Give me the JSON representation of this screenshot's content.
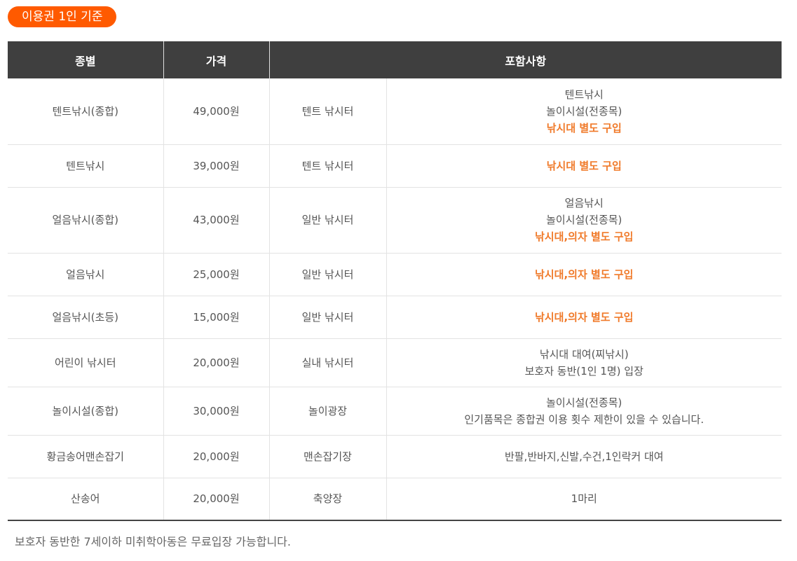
{
  "badge": {
    "label": "이용권 1인 기준"
  },
  "table": {
    "headers": [
      "종별",
      "가격",
      "포함사항"
    ],
    "rows": [
      {
        "type": "텐트낚시(종합)",
        "price": "49,000원",
        "area": "텐트 낚시터",
        "lines": [
          {
            "text": "텐트낚시",
            "accent": false
          },
          {
            "text": "놀이시설(전종목)",
            "accent": false
          },
          {
            "text": "낚시대 별도 구입",
            "accent": true
          }
        ]
      },
      {
        "type": "텐트낚시",
        "price": "39,000원",
        "area": "텐트 낚시터",
        "lines": [
          {
            "text": "낚시대 별도 구입",
            "accent": true
          }
        ]
      },
      {
        "type": "얼음낚시(종합)",
        "price": "43,000원",
        "area": "일반 낚시터",
        "lines": [
          {
            "text": "얼음낚시",
            "accent": false
          },
          {
            "text": "놀이시설(전종목)",
            "accent": false
          },
          {
            "text": "낚시대,의자 별도 구입",
            "accent": true
          }
        ]
      },
      {
        "type": "얼음낚시",
        "price": "25,000원",
        "area": "일반 낚시터",
        "lines": [
          {
            "text": "낚시대,의자 별도 구입",
            "accent": true
          }
        ]
      },
      {
        "type": "얼음낚시(초등)",
        "price": "15,000원",
        "area": "일반 낚시터",
        "lines": [
          {
            "text": "낚시대,의자 별도 구입",
            "accent": true
          }
        ]
      },
      {
        "type": "어린이 낚시터",
        "price": "20,000원",
        "area": "실내 낚시터",
        "lines": [
          {
            "text": "낚시대 대여(찌낚시)",
            "accent": false
          },
          {
            "text": "보호자 동반(1인 1명) 입장",
            "accent": false
          }
        ]
      },
      {
        "type": "놀이시설(종합)",
        "price": "30,000원",
        "area": "놀이광장",
        "lines": [
          {
            "text": "놀이시설(전종목)",
            "accent": false
          },
          {
            "text": "인기품목은 종합권 이용 횟수 제한이 있을 수 있습니다.",
            "accent": false
          }
        ]
      },
      {
        "type": "황금송어맨손잡기",
        "price": "20,000원",
        "area": "맨손잡기장",
        "lines": [
          {
            "text": "반팔,반바지,신발,수건,1인락커 대여",
            "accent": false
          }
        ]
      },
      {
        "type": "산송어",
        "price": "20,000원",
        "area": "축양장",
        "lines": [
          {
            "text": "1마리",
            "accent": false
          }
        ]
      }
    ]
  },
  "note": {
    "text": "보호자 동반한 7세이하 미취학아동은 무료입장 가능합니다."
  },
  "colors": {
    "accent": "#f07a2a",
    "badge": "#ff5a00",
    "header_bg": "#3f3f3f"
  }
}
